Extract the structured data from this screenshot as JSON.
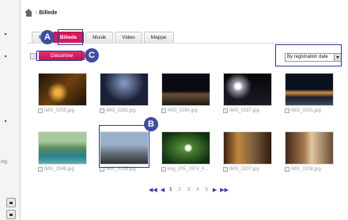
{
  "breadcrumb": {
    "separator": "›",
    "current": "Billede"
  },
  "tabs": [
    {
      "label": "Mi",
      "active": false
    },
    {
      "label": "Billede",
      "active": true
    },
    {
      "label": "Musik",
      "active": false
    },
    {
      "label": "Video",
      "active": false
    },
    {
      "label": "Mappe",
      "active": false
    }
  ],
  "toolbar": {
    "slideshow_label": "Diasshow",
    "sort_selected": "By registration date"
  },
  "annotations": {
    "a": "A",
    "b": "B",
    "c": "C"
  },
  "left_strip": {
    "cut_label": "ing"
  },
  "photos": [
    {
      "caption": "IMG_0255.jpg"
    },
    {
      "caption": "IMG_0282.jpg"
    },
    {
      "caption": "IMG_0284.jpg"
    },
    {
      "caption": "IMG_0287.jpg"
    },
    {
      "caption": "IMG_0291.jpg"
    },
    {
      "caption": "IMG_2548.jpg"
    },
    {
      "caption": "IMG_0195.jpg"
    },
    {
      "caption": "img_205_1974_0..."
    },
    {
      "caption": "IMG_0207.jpg"
    },
    {
      "caption": "IMG_0208.jpg"
    }
  ],
  "pager": {
    "first": "◀◀",
    "prev": "◀",
    "pages": [
      "1",
      "2",
      "3",
      "4",
      "5"
    ],
    "current_page": "1",
    "next": "▶",
    "last": "▶▶"
  },
  "colors": {
    "accent": "#d9185a",
    "annotation": "#404ca0"
  }
}
